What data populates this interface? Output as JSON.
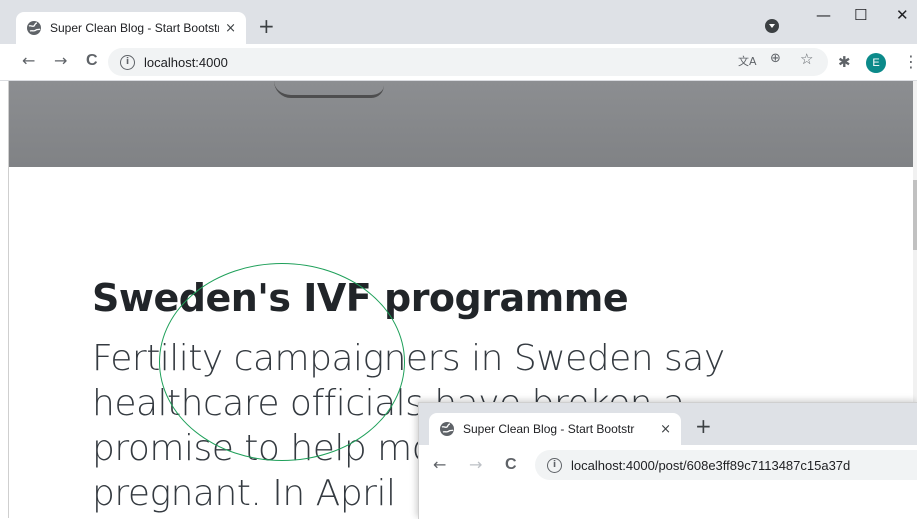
{
  "browser": {
    "tab_title": "Super Clean Blog - Start Bootstr",
    "tab_close": "×",
    "new_tab": "+",
    "window_minimize": "—",
    "window_maximize": "☐",
    "window_close": "✕",
    "nav_back": "←",
    "nav_forward": "→",
    "nav_reload": "C",
    "info_glyph": "i",
    "url": "localhost:4000",
    "translate_icon": "文A",
    "zoom_icon": "⊕",
    "bookmark_icon": "☆",
    "extensions_icon": "✱",
    "avatar_letter": "E",
    "menu_icon": "⋮"
  },
  "post": {
    "title": "Sweden's IVF programme",
    "subtitle": "Fertility campaigners in Sweden say healthcare officials have broken a promise to help more women get pregnant. In April"
  },
  "second_window": {
    "tab_title": "Super Clean Blog - Start Bootstr",
    "tab_close": "×",
    "new_tab": "+",
    "nav_back": "←",
    "nav_forward": "→",
    "nav_reload": "C",
    "info_glyph": "i",
    "url": "localhost:4000/post/608e3ff89c7113487c15a37d"
  },
  "colors": {
    "tabstrip": "#dee1e6",
    "annotation": "#1fa05a",
    "hero": "#86888b",
    "avatar": "#0b8a8a"
  }
}
